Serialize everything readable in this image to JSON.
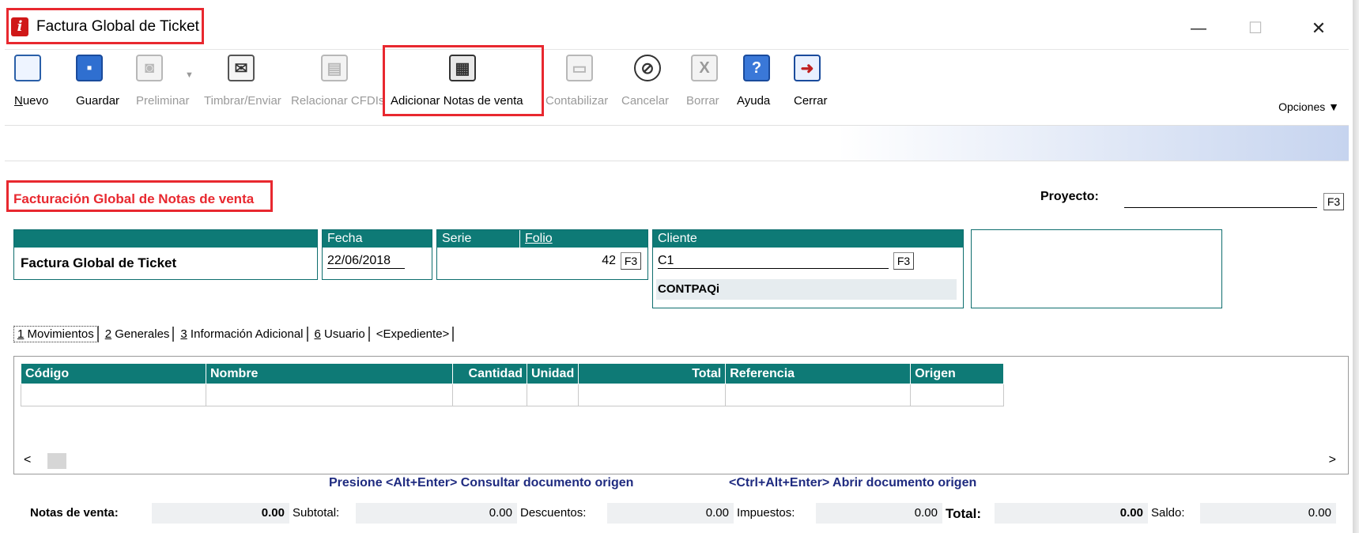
{
  "window": {
    "title": "Factura Global de Ticket",
    "minimize": "—",
    "maximize": "☐",
    "close": "✕"
  },
  "toolbar": {
    "items": [
      {
        "label": "Nuevo",
        "u": "N",
        "rest": "uevo",
        "enabled": true
      },
      {
        "label": "Guardar",
        "enabled": true
      },
      {
        "label": "Preliminar",
        "enabled": false
      },
      {
        "label": "Timbrar/Enviar",
        "enabled": false
      },
      {
        "label": "Relacionar CFDIs",
        "enabled": false
      },
      {
        "label": "Adicionar Notas de venta",
        "enabled": true
      },
      {
        "label": "Contabilizar",
        "enabled": false
      },
      {
        "label": "Cancelar",
        "enabled": false
      },
      {
        "label": "Borrar",
        "enabled": false
      },
      {
        "label": "Ayuda",
        "enabled": true
      },
      {
        "label": "Cerrar",
        "enabled": true
      }
    ],
    "dropdown_arrow": "▼",
    "opciones": "Opciones ▼"
  },
  "section": {
    "title": "Facturación Global de Notas de venta"
  },
  "proyecto": {
    "label": "Proyecto:",
    "value": "",
    "f3": "F3"
  },
  "document": {
    "concept": "Factura Global de Ticket",
    "fecha_label": "Fecha",
    "fecha": "22/06/2018",
    "serie_label": "Serie",
    "folio_label": "Folio",
    "serie": "",
    "folio": "42",
    "folio_f3": "F3",
    "cliente_label": "Cliente",
    "cliente_code": "C1",
    "cliente_f3": "F3",
    "cliente_name": "CONTPAQi"
  },
  "tabs": [
    {
      "label": "1 Movimientos",
      "active": true
    },
    {
      "label": "2 Generales",
      "active": false
    },
    {
      "label": "3 Información Adicional",
      "active": false
    },
    {
      "label": "6 Usuario",
      "active": false
    },
    {
      "label": "<Expediente>",
      "active": false
    }
  ],
  "grid": {
    "columns": [
      "Código",
      "Nombre",
      "Cantidad",
      "Unidad",
      "Total",
      "Referencia",
      "Origen"
    ],
    "rows": [
      [
        "",
        "",
        "",
        "",
        "",
        "",
        ""
      ]
    ],
    "scroll_left": "<",
    "scroll_right": ">"
  },
  "hints": {
    "consultar": "Presione <Alt+Enter> Consultar documento origen",
    "abrir": "<Ctrl+Alt+Enter> Abrir documento origen"
  },
  "totals": {
    "notas_label": "Notas de venta:",
    "notas": "0.00",
    "subtotal_label": "Subtotal:",
    "subtotal": "0.00",
    "descuentos_label": "Descuentos:",
    "descuentos": "0.00",
    "impuestos_label": "Impuestos:",
    "impuestos": "0.00",
    "total_label": "Total:",
    "total": "0.00",
    "saldo_label": "Saldo:",
    "saldo": "0.00"
  },
  "colors": {
    "teal_header": "#0e7a76",
    "highlight": "#e8282f",
    "hint_text": "#1f2b80",
    "app_icon": "#d01818"
  }
}
